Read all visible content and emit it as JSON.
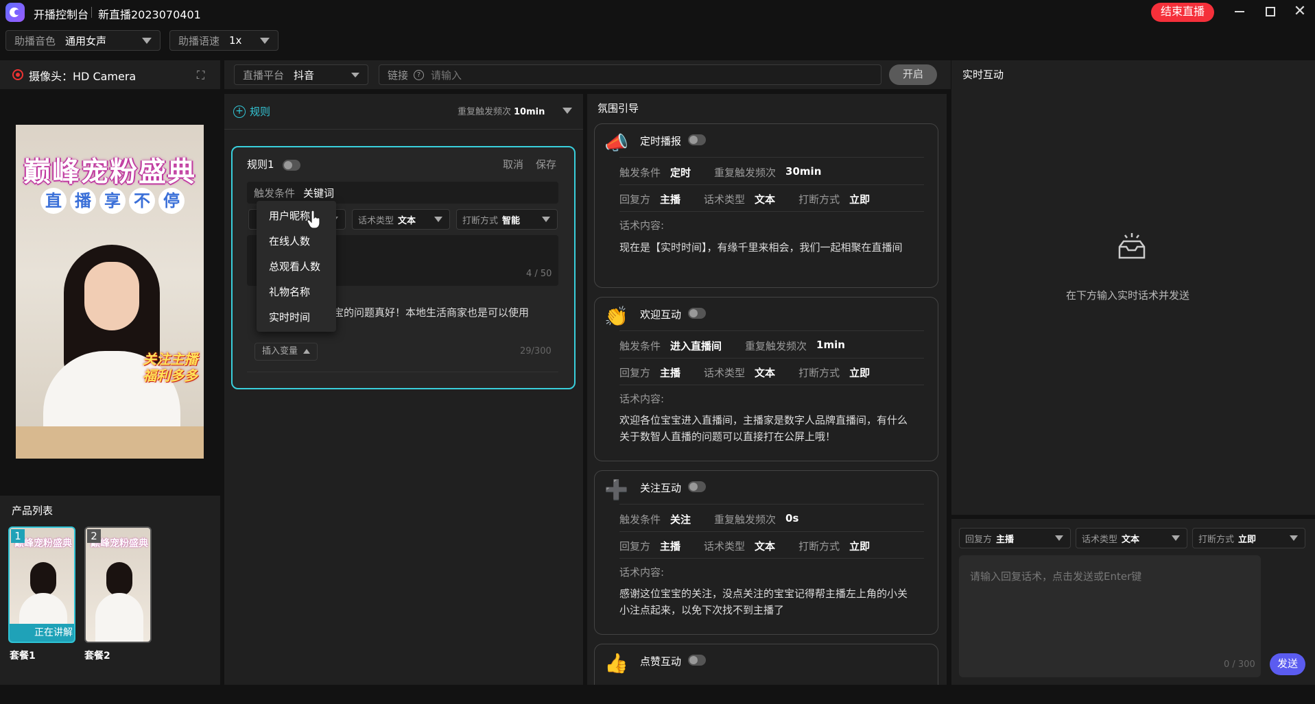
{
  "app": {
    "title": "开播控制台",
    "live_name": "新直播2023070401",
    "end_button": "结束直播"
  },
  "toolbar": {
    "voice": {
      "label": "助播音色",
      "value": "通用女声"
    },
    "speed": {
      "label": "助播语速",
      "value": "1x"
    }
  },
  "camera": {
    "title": "摄像头：HD Camera"
  },
  "preview": {
    "title": "巅峰宠粉盛典",
    "subtitle_chars": [
      "直",
      "播",
      "享",
      "不",
      "停"
    ],
    "badge_line1": "关注主播",
    "badge_line2": "福利多多"
  },
  "products": {
    "title": "产品列表",
    "items": [
      {
        "num": "1",
        "name": "套餐1",
        "tag": "正在讲解",
        "card_title": "巅峰宠粉盛典"
      },
      {
        "num": "2",
        "name": "套餐2",
        "card_title": "巅峰宠粉盛典"
      }
    ]
  },
  "platform": {
    "label": "直播平台",
    "value": "抖音"
  },
  "link": {
    "label": "链接",
    "placeholder": "请输入"
  },
  "open_button": "开启",
  "rules": {
    "add_label": "规则",
    "freq_label": "重复触发频次",
    "freq_value": "10min",
    "card": {
      "title": "规则1",
      "cancel": "取消",
      "save": "保存",
      "trigger_label": "触发条件",
      "trigger_value": "关键词",
      "type_label": "话术类型",
      "type_value": "文本",
      "interrupt_label": "打断方式",
      "interrupt_value": "智能",
      "keyword_count": "4 / 50",
      "reply_text": "宝的问题真好！本地生活商家也是可以使用",
      "insert_var": "插入变量",
      "reply_count": "29/300"
    },
    "dropdown": [
      "用户昵称",
      "在线人数",
      "总观看人数",
      "礼物名称",
      "实时时间"
    ]
  },
  "atmosphere": {
    "title": "氛围引导",
    "cards": [
      {
        "icon": "📣",
        "title": "定时播报",
        "trigger_label": "触发条件",
        "trigger": "定时",
        "freq_label": "重复触发频次",
        "freq": "30min",
        "reply_label": "回复方",
        "reply": "主播",
        "type_label": "话术类型",
        "type": "文本",
        "int_label": "打断方式",
        "int": "立即",
        "content_label": "话术内容:",
        "content": "现在是【实时时间】，有缘千里来相会，我们一起相聚在直播间"
      },
      {
        "icon": "👏",
        "title": "欢迎互动",
        "trigger_label": "触发条件",
        "trigger": "进入直播间",
        "freq_label": "重复触发频次",
        "freq": "1min",
        "reply_label": "回复方",
        "reply": "主播",
        "type_label": "话术类型",
        "type": "文本",
        "int_label": "打断方式",
        "int": "立即",
        "content_label": "话术内容:",
        "content": "欢迎各位宝宝进入直播间，主播家是数字人品牌直播间，有什么关于数智人直播的问题可以直接打在公屏上哦！"
      },
      {
        "icon": "➕",
        "title": "关注互动",
        "trigger_label": "触发条件",
        "trigger": "关注",
        "freq_label": "重复触发频次",
        "freq": "0s",
        "reply_label": "回复方",
        "reply": "主播",
        "type_label": "话术类型",
        "type": "文本",
        "int_label": "打断方式",
        "int": "立即",
        "content_label": "话术内容:",
        "content": "感谢这位宝宝的关注，没点关注的宝宝记得帮主播左上角的小关小注点起来，以免下次找不到主播了"
      },
      {
        "icon": "👍",
        "title": "点赞互动"
      }
    ]
  },
  "realtime": {
    "title": "实时互动",
    "empty_text": "在下方输入实时话术并发送",
    "reply_label": "回复方",
    "reply_value": "主播",
    "type_label": "话术类型",
    "type_value": "文本",
    "int_label": "打断方式",
    "int_value": "立即",
    "input_placeholder": "请输入回复话术，点击发送或Enter键",
    "count": "0 / 300",
    "send": "发送"
  }
}
